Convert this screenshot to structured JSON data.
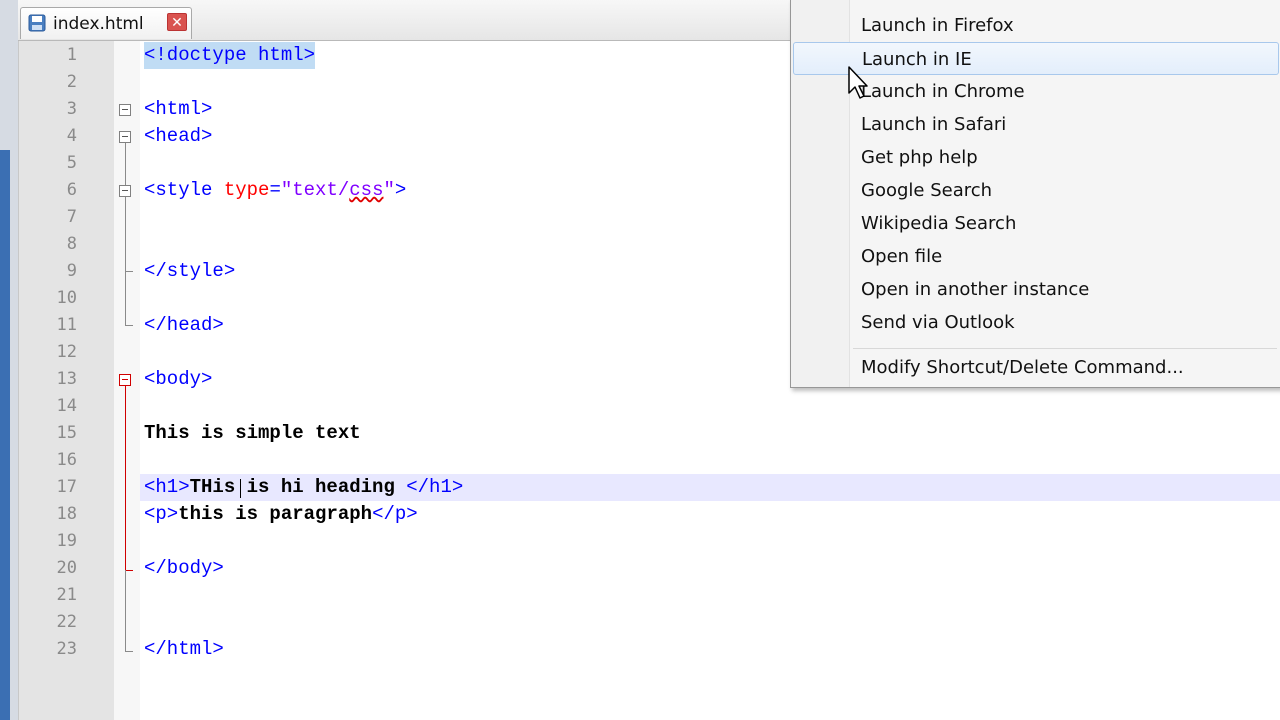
{
  "tab": {
    "label": "index.html",
    "close_label": "✕"
  },
  "lines": [
    {
      "n": "1"
    },
    {
      "n": "2"
    },
    {
      "n": "3"
    },
    {
      "n": "4"
    },
    {
      "n": "5"
    },
    {
      "n": "6"
    },
    {
      "n": "7"
    },
    {
      "n": "8"
    },
    {
      "n": "9"
    },
    {
      "n": "10"
    },
    {
      "n": "11"
    },
    {
      "n": "12"
    },
    {
      "n": "13"
    },
    {
      "n": "14"
    },
    {
      "n": "15"
    },
    {
      "n": "16"
    },
    {
      "n": "17"
    },
    {
      "n": "18"
    },
    {
      "n": "19"
    },
    {
      "n": "20"
    },
    {
      "n": "21"
    },
    {
      "n": "22"
    },
    {
      "n": "23"
    }
  ],
  "code": {
    "l1": "<!doctype html>",
    "l3": "<html>",
    "l4": "<head>",
    "l6_open": "<style ",
    "l6_attr": "type",
    "l6_eq": "=",
    "l6_str_a": "\"text/",
    "l6_str_b": "css",
    "l6_str_c": "\"",
    "l6_close": ">",
    "l9": "</style>",
    "l11": "</head>",
    "l13": "<body>",
    "l15": "This is simple text",
    "l17_open": "<h1>",
    "l17_text": "THis is hi heading ",
    "l17_close": "</h1>",
    "l18_open": "<p>",
    "l18_text": "this is paragraph",
    "l18_close": "</p>",
    "l20": "</body>",
    "l23": "</html>"
  },
  "context_menu": {
    "items": [
      "Launch in Firefox",
      "Launch in IE",
      "Launch in Chrome",
      "Launch in Safari",
      "Get php help",
      "Google Search",
      "Wikipedia Search",
      "Open file",
      "Open in another instance",
      "Send via Outlook"
    ],
    "footer_item": "Modify Shortcut/Delete Command...",
    "hovered_item": "Launch in IE"
  },
  "colors": {
    "tag": "#0000ff",
    "attribute": "#ff0000",
    "string": "#8000ff",
    "current_line": "#e8e8ff",
    "menu_hover": "#e3eefb"
  }
}
